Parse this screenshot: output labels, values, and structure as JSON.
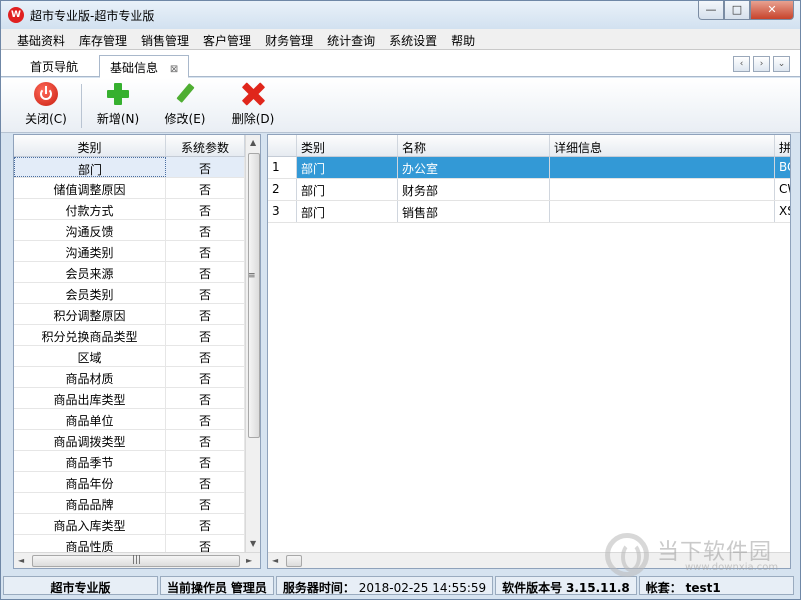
{
  "window": {
    "title": "超市专业版-超市专业版",
    "icon_label": "W",
    "controls": {
      "minimize": "—",
      "maximize": "□",
      "close": "✕"
    }
  },
  "menu": [
    "基础资料",
    "库存管理",
    "销售管理",
    "客户管理",
    "财务管理",
    "统计查询",
    "系统设置",
    "帮助"
  ],
  "tabs": {
    "home": "首页导航",
    "active": "基础信息",
    "close_glyph": "⊠",
    "nav": [
      "‹",
      "›",
      "⌄"
    ]
  },
  "toolbar": {
    "close": "关闭(C)",
    "add": "新增(N)",
    "edit": "修改(E)",
    "delete": "删除(D)"
  },
  "left_table": {
    "columns": [
      "类别",
      "系统参数"
    ],
    "rows": [
      [
        "部门",
        "否"
      ],
      [
        "储值调整原因",
        "否"
      ],
      [
        "付款方式",
        "否"
      ],
      [
        "沟通反馈",
        "否"
      ],
      [
        "沟通类别",
        "否"
      ],
      [
        "会员来源",
        "否"
      ],
      [
        "会员类别",
        "否"
      ],
      [
        "积分调整原因",
        "否"
      ],
      [
        "积分兑换商品类型",
        "否"
      ],
      [
        "区域",
        "否"
      ],
      [
        "商品材质",
        "否"
      ],
      [
        "商品出库类型",
        "否"
      ],
      [
        "商品单位",
        "否"
      ],
      [
        "商品调拨类型",
        "否"
      ],
      [
        "商品季节",
        "否"
      ],
      [
        "商品年份",
        "否"
      ],
      [
        "商品品牌",
        "否"
      ],
      [
        "商品入库类型",
        "否"
      ],
      [
        "商品性质",
        "否"
      ]
    ],
    "selected_index": 0,
    "scroll": {
      "up": "▲",
      "down": "▼",
      "left": "◄",
      "right": "►",
      "grip_v": "≡",
      "grip_h": "|||"
    }
  },
  "right_table": {
    "columns": [
      "",
      "类别",
      "名称",
      "详细信息",
      "拼"
    ],
    "rows": [
      [
        "1",
        "部门",
        "办公室",
        "",
        "BG"
      ],
      [
        "2",
        "部门",
        "财务部",
        "",
        "CW"
      ],
      [
        "3",
        "部门",
        "销售部",
        "",
        "XS"
      ]
    ],
    "selected_index": 0,
    "scroll": {
      "left": "◄"
    }
  },
  "status": {
    "app_name": "超市专业版",
    "operator_label": "当前操作员",
    "operator": "管理员",
    "server_time_label": "服务器时间：",
    "server_time": "2018-02-25 14:55:59",
    "version_label": "软件版本号",
    "version": "3.15.11.8",
    "account_label": "帐套：",
    "account": "test1"
  },
  "watermark": {
    "text": "当下软件园",
    "url": "www.downxia.com"
  }
}
